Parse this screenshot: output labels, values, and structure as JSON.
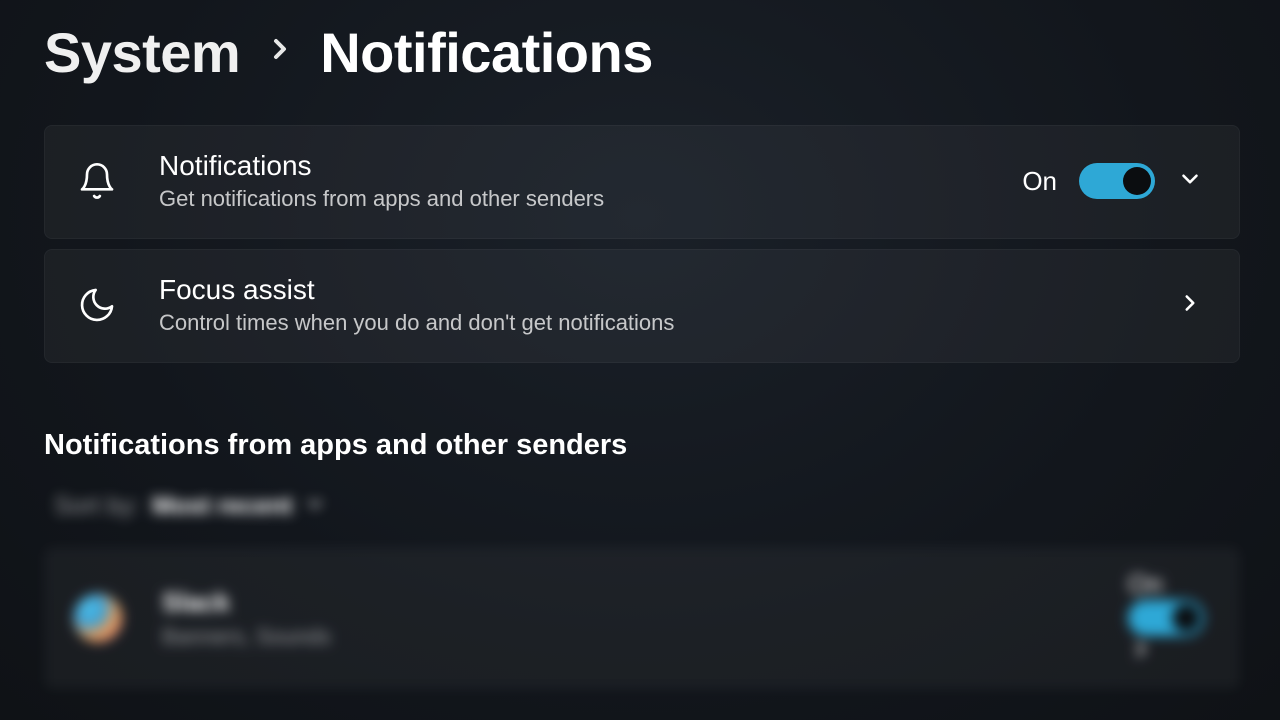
{
  "breadcrumb": {
    "parent": "System",
    "current": "Notifications"
  },
  "cards": {
    "notifications": {
      "title": "Notifications",
      "subtitle": "Get notifications from apps and other senders",
      "toggle_state": "On"
    },
    "focus_assist": {
      "title": "Focus assist",
      "subtitle": "Control times when you do and don't get notifications"
    }
  },
  "section_heading": "Notifications from apps and other senders",
  "sort": {
    "label": "Sort by:",
    "value": "Most recent"
  },
  "apps": [
    {
      "name": "Slack",
      "detail": "Banners, Sounds",
      "toggle_state": "On"
    }
  ]
}
